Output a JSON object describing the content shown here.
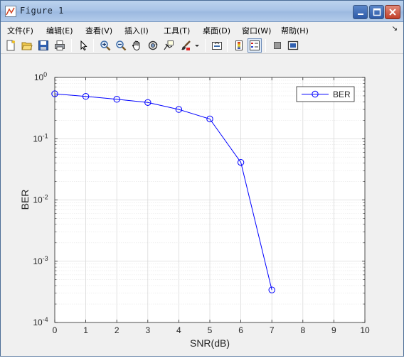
{
  "window": {
    "title": "Figure 1",
    "controls": {
      "minimize": "minimize",
      "maximize": "maximize",
      "close": "close"
    }
  },
  "menu": {
    "items": [
      {
        "label": "文件(F)"
      },
      {
        "label": "编辑(E)"
      },
      {
        "label": "查看(V)"
      },
      {
        "label": "插入(I)"
      },
      {
        "label": "工具(T)"
      },
      {
        "label": "桌面(D)"
      },
      {
        "label": "窗口(W)"
      },
      {
        "label": "帮助(H)"
      }
    ],
    "overflow_arrow": "↘"
  },
  "toolbar": {
    "buttons": [
      {
        "icon": "new-figure-icon"
      },
      {
        "icon": "open-file-icon"
      },
      {
        "icon": "save-icon"
      },
      {
        "icon": "print-icon"
      },
      {
        "icon": "pointer-icon"
      },
      {
        "icon": "zoom-in-icon"
      },
      {
        "icon": "zoom-out-icon"
      },
      {
        "icon": "pan-icon"
      },
      {
        "icon": "rotate-3d-icon"
      },
      {
        "icon": "data-cursor-icon"
      },
      {
        "icon": "brush-icon"
      },
      {
        "icon": "link-plot-icon"
      },
      {
        "icon": "colorbar-icon"
      },
      {
        "icon": "legend-icon"
      },
      {
        "icon": "hide-plot-tools-icon"
      },
      {
        "icon": "show-plot-tools-icon"
      }
    ]
  },
  "colors": {
    "series": "#0000ff",
    "grid": "#d9d9d9",
    "axes": "#262626",
    "figure_bg": "#f0f0f0"
  },
  "chart_data": {
    "type": "line",
    "title": "",
    "xlabel": "SNR(dB)",
    "ylabel": "BER",
    "xlim": [
      0,
      10
    ],
    "ylim": [
      0.0001,
      1
    ],
    "yscale": "log",
    "grid": true,
    "legend_position": "top-right",
    "x_ticks": [
      "0",
      "1",
      "2",
      "3",
      "4",
      "5",
      "6",
      "7",
      "8",
      "9",
      "10"
    ],
    "y_ticks": [
      {
        "base": "10",
        "exp": "0"
      },
      {
        "base": "10",
        "exp": "-1"
      },
      {
        "base": "10",
        "exp": "-2"
      },
      {
        "base": "10",
        "exp": "-3"
      },
      {
        "base": "10",
        "exp": "-4"
      }
    ],
    "series": [
      {
        "name": "BER",
        "marker": "circle",
        "x": [
          0,
          1,
          2,
          3,
          4,
          5,
          6,
          7
        ],
        "y": [
          0.54,
          0.49,
          0.44,
          0.39,
          0.3,
          0.21,
          0.041,
          0.00034
        ]
      }
    ]
  }
}
